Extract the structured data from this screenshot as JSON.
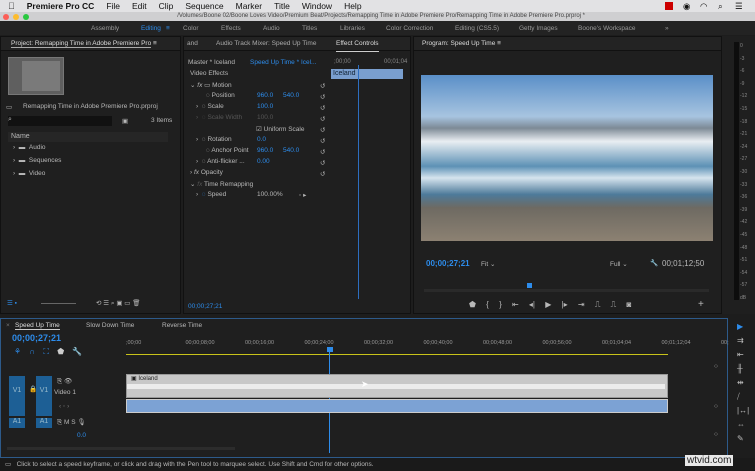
{
  "menubar": {
    "app": "Premiere Pro CC",
    "items": [
      "File",
      "Edit",
      "Clip",
      "Sequence",
      "Marker",
      "Title",
      "Window",
      "Help"
    ]
  },
  "titlebar": {
    "path": "/Volumes/Boone 02/Boone Loves Video/Premium Beat/Projects/Remapping Time in Adobe Premiere Pro/Remapping Time in Adobe Premiere Pro.prproj *"
  },
  "workspaces": [
    "Assembly",
    "Editing",
    "Color",
    "Effects",
    "Audio",
    "Titles",
    "Libraries",
    "Color Correction",
    "Editing (CS5.5)",
    "Getty Images",
    "Boone's Workspace"
  ],
  "project": {
    "title": "Project: Remapping Time in Adobe Premiere Pro",
    "filename": "Remapping Time in Adobe Premiere Pro.prproj",
    "items_count": "3 Items",
    "column_name": "Name",
    "folders": [
      "Audio",
      "Sequences",
      "Video"
    ]
  },
  "effect_controls": {
    "tabs": [
      "and",
      "Audio Track Mixer: Speed Up Time",
      "Effect Controls"
    ],
    "master": "Master * Iceland",
    "sequence": "Speed Up Time * Icel...",
    "ruler_start": ";00;00",
    "ruler_end": "00;01;04",
    "clip_label": "Iceland",
    "section": "Video Effects",
    "rows": [
      {
        "name": "Motion",
        "v1": "",
        "v2": ""
      },
      {
        "name": "Position",
        "v1": "960.0",
        "v2": "540.0"
      },
      {
        "name": "Scale",
        "v1": "100.0",
        "v2": ""
      },
      {
        "name": "Scale Width",
        "v1": "100.0",
        "v2": ""
      },
      {
        "name": "Uniform Scale",
        "v1": "",
        "v2": ""
      },
      {
        "name": "Rotation",
        "v1": "0.0",
        "v2": ""
      },
      {
        "name": "Anchor Point",
        "v1": "960.0",
        "v2": "540.0"
      },
      {
        "name": "Anti-flicker ...",
        "v1": "0.00",
        "v2": ""
      },
      {
        "name": "Opacity",
        "v1": "",
        "v2": ""
      },
      {
        "name": "Time Remapping",
        "v1": "",
        "v2": ""
      },
      {
        "name": "Speed",
        "v1": "100.00%",
        "v2": ""
      }
    ],
    "timecode": "00;00;27;21"
  },
  "program": {
    "title": "Program: Speed Up Time",
    "timecode": "00;00;27;21",
    "fit": "Fit",
    "quality": "Full",
    "duration": "00;01;12;50"
  },
  "meters": [
    "0",
    "-3",
    "-6",
    "-9",
    "-12",
    "-15",
    "-18",
    "-21",
    "-24",
    "-27",
    "-30",
    "-33",
    "-36",
    "-39",
    "-42",
    "-45",
    "-48",
    "-51",
    "-54",
    "-57",
    "dB"
  ],
  "timeline": {
    "tabs": [
      "Speed Up Time",
      "Slow Down Time",
      "Reverse Time"
    ],
    "timecode": "00;00;27;21",
    "ruler": [
      ";00;00",
      "00;00;08;00",
      "00;00;16;00",
      "00;00;24;00",
      "00;00;32;00",
      "00;00;40;00",
      "00;00;48;00",
      "00;00;56;00",
      "00;01;04;04",
      "00;01;12;04",
      "00;"
    ],
    "v1": "V1",
    "video_label": "Video 1",
    "a1": "A1",
    "audio_vol": "0.0",
    "clip": "Iceland"
  },
  "status": "Click to select a speed keyframe, or click and drag with the Pen tool to marquee select. Use Shift and Cmd for other options.",
  "watermark": "wtvid.com"
}
